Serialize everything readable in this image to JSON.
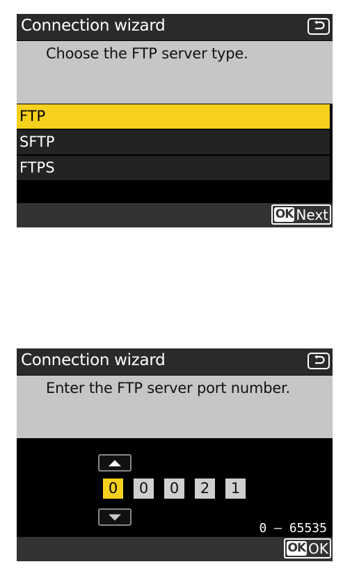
{
  "screen1": {
    "title": "Connection wizard",
    "prompt": "Choose the FTP server type.",
    "options": [
      {
        "label": "FTP",
        "selected": true
      },
      {
        "label": "SFTP",
        "selected": false
      },
      {
        "label": "FTPS",
        "selected": false
      }
    ],
    "ok_badge": "OK",
    "ok_label": "Next",
    "back_icon": "return-arrow-icon"
  },
  "screen2": {
    "title": "Connection wizard",
    "prompt": "Enter the FTP server port number.",
    "digits": [
      "0",
      "0",
      "0",
      "2",
      "1"
    ],
    "active_digit_index": 0,
    "range": "0 – 65535",
    "ok_badge": "OK",
    "ok_label": "OK",
    "back_icon": "return-arrow-icon"
  },
  "colors": {
    "highlight": "#f5d01c",
    "prompt_bg": "#c6c6c6",
    "title_bg": "#2a2a2a",
    "screen_bg": "#000000"
  }
}
